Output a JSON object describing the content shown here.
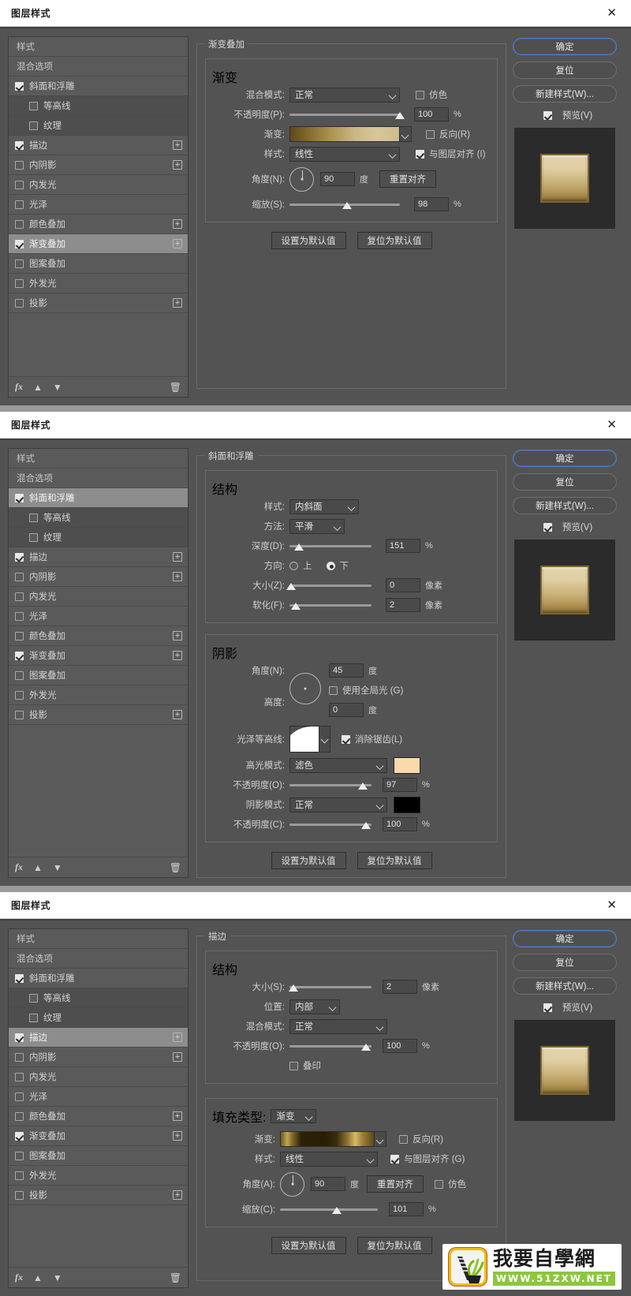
{
  "window": {
    "title": "图层样式",
    "close_label": "✕"
  },
  "styles_panel": {
    "items": [
      {
        "label": "样式",
        "checkbox": false,
        "has_checkbox": false,
        "plus": false,
        "sub": false
      },
      {
        "label": "混合选项",
        "checkbox": false,
        "has_checkbox": false,
        "plus": false,
        "sub": false
      },
      {
        "label": "斜面和浮雕",
        "checkbox": true,
        "has_checkbox": true,
        "plus": false,
        "sub": false
      },
      {
        "label": "等高线",
        "checkbox": false,
        "has_checkbox": true,
        "plus": false,
        "sub": true
      },
      {
        "label": "纹理",
        "checkbox": false,
        "has_checkbox": true,
        "plus": false,
        "sub": true
      },
      {
        "label": "描边",
        "checkbox": true,
        "has_checkbox": true,
        "plus": true,
        "sub": false
      },
      {
        "label": "内阴影",
        "checkbox": false,
        "has_checkbox": true,
        "plus": true,
        "sub": false
      },
      {
        "label": "内发光",
        "checkbox": false,
        "has_checkbox": true,
        "plus": false,
        "sub": false
      },
      {
        "label": "光泽",
        "checkbox": false,
        "has_checkbox": true,
        "plus": false,
        "sub": false
      },
      {
        "label": "颜色叠加",
        "checkbox": false,
        "has_checkbox": true,
        "plus": true,
        "sub": false
      },
      {
        "label": "渐变叠加",
        "checkbox": true,
        "has_checkbox": true,
        "plus": true,
        "sub": false
      },
      {
        "label": "图案叠加",
        "checkbox": false,
        "has_checkbox": true,
        "plus": false,
        "sub": false
      },
      {
        "label": "外发光",
        "checkbox": false,
        "has_checkbox": true,
        "plus": false,
        "sub": false
      },
      {
        "label": "投影",
        "checkbox": false,
        "has_checkbox": true,
        "plus": true,
        "sub": false
      }
    ],
    "selected_panel1": "渐变叠加",
    "selected_panel2": "斜面和浮雕",
    "selected_panel3": "描边",
    "footer": {
      "fx": "fx",
      "move_up": "▲",
      "move_down": "▼",
      "delete": "🗑"
    }
  },
  "buttons": {
    "ok": "确定",
    "reset": "复位",
    "new_style": "新建样式(W)...",
    "preview": "预览(V)",
    "preview_checked": true,
    "set_default": "设置为默认值",
    "reset_default": "复位为默认值",
    "reset_align": "重置对齐"
  },
  "panel1": {
    "legend": "渐变叠加",
    "section_legend": "渐变",
    "blend_mode": {
      "label": "混合模式:",
      "value": "正常"
    },
    "dither": {
      "label": "仿色",
      "checked": false
    },
    "opacity": {
      "label": "不透明度(P):",
      "value": "100",
      "unit": "%",
      "percent": 100
    },
    "gradient": {
      "label": "渐变:"
    },
    "reverse": {
      "label": "反向(R)",
      "checked": false
    },
    "style": {
      "label": "样式:",
      "value": "线性"
    },
    "align_layer": {
      "label": "与图层对齐 (I)",
      "checked": true
    },
    "angle": {
      "label": "角度(N):",
      "value": "90",
      "unit": "度"
    },
    "scale": {
      "label": "缩放(S):",
      "value": "98",
      "unit": "%",
      "percent": 52
    }
  },
  "panel2": {
    "legend": "斜面和浮雕",
    "structure_legend": "结构",
    "style": {
      "label": "样式:",
      "value": "内斜面"
    },
    "technique": {
      "label": "方法:",
      "value": "平滑"
    },
    "depth": {
      "label": "深度(D):",
      "value": "151",
      "unit": "%",
      "percent": 12
    },
    "direction": {
      "label": "方向:",
      "up": "上",
      "down": "下",
      "selected": "下"
    },
    "size": {
      "label": "大小(Z):",
      "value": "0",
      "unit": "像素",
      "percent": 2
    },
    "soften": {
      "label": "软化(F):",
      "value": "2",
      "unit": "像素",
      "percent": 8
    },
    "shading_legend": "阴影",
    "angle": {
      "label": "角度(N):",
      "value": "45",
      "unit": "度"
    },
    "use_global_light": {
      "label": "使用全局光 (G)",
      "checked": false
    },
    "altitude": {
      "label": "高度:",
      "value": "0",
      "unit": "度"
    },
    "gloss_contour": {
      "label": "光泽等高线:"
    },
    "anti_alias": {
      "label": "消除锯齿(L)",
      "checked": true
    },
    "highlight_mode": {
      "label": "高光模式:",
      "value": "滤色",
      "color": "#fad9ab"
    },
    "highlight_opacity": {
      "label": "不透明度(O):",
      "value": "97",
      "unit": "%",
      "percent": 89
    },
    "shadow_mode": {
      "label": "阴影模式:",
      "value": "正常",
      "color": "#000000"
    },
    "shadow_opacity": {
      "label": "不透明度(C):",
      "value": "100",
      "unit": "%",
      "percent": 93
    }
  },
  "panel3": {
    "legend": "描边",
    "structure_legend": "结构",
    "size": {
      "label": "大小(S):",
      "value": "2",
      "unit": "像素",
      "percent": 5
    },
    "position": {
      "label": "位置:",
      "value": "内部"
    },
    "blend_mode": {
      "label": "混合模式:",
      "value": "正常"
    },
    "opacity": {
      "label": "不透明度(O):",
      "value": "100",
      "unit": "%",
      "percent": 93
    },
    "overprint": {
      "label": "叠印",
      "checked": false
    },
    "fill_type": {
      "label": "填充类型:",
      "value": "渐变"
    },
    "gradient": {
      "label": "渐变:"
    },
    "reverse": {
      "label": "反向(R)",
      "checked": false
    },
    "style": {
      "label": "样式:",
      "value": "线性"
    },
    "align_layer": {
      "label": "与图层对齐 (G)",
      "checked": true
    },
    "angle": {
      "label": "角度(A):",
      "value": "90",
      "unit": "度"
    },
    "dither": {
      "label": "仿色",
      "checked": false
    },
    "scale": {
      "label": "缩放(C):",
      "value": "101",
      "unit": "%",
      "percent": 58
    }
  },
  "watermark": {
    "title": "我要自學網",
    "url": "WWW.51ZXW.NET"
  },
  "colors": {
    "dialog_bg": "#535353",
    "list_bg": "#5a5a5a",
    "selected": "#8d8d8d",
    "accent_blue": "#4f7fd4",
    "highlight_color": "#fad9ab",
    "shadow_color": "#000000"
  }
}
